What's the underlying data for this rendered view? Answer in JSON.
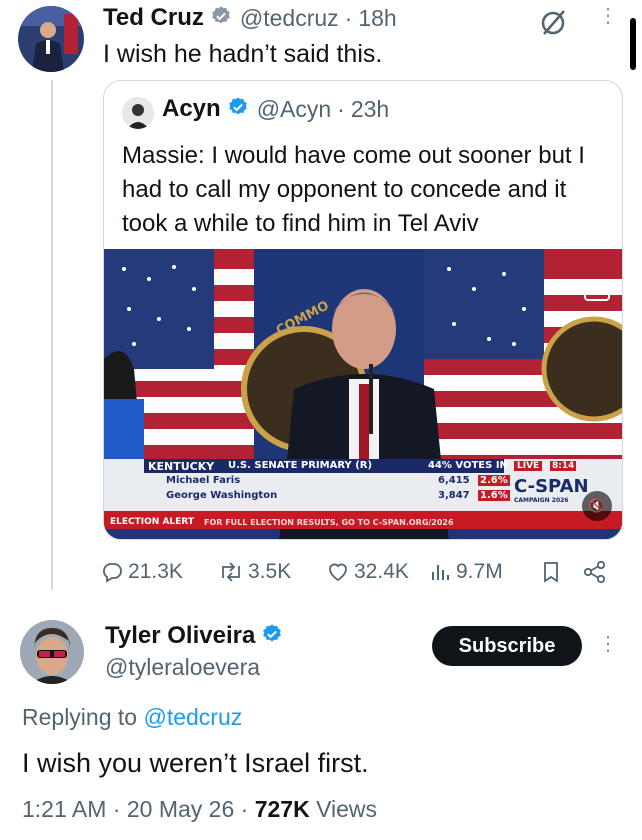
{
  "main_tweet": {
    "author": "Ted Cruz",
    "handle": "@tedcruz",
    "time": "18h",
    "text": "I wish he hadn’t said this."
  },
  "quote_tweet": {
    "author": "Acyn",
    "handle": "@Acyn",
    "time": "23h",
    "text": "Massie: I would have come out sooner but I had to call my opponent to concede and it took a while to find him in Tel Aviv",
    "video": {
      "lower_third": {
        "state": "KENTUCKY",
        "race": "U.S. SENATE PRIMARY (R)",
        "votes_in": "44% VOTES IN",
        "live": "LIVE",
        "time": "8:14",
        "candidates": [
          {
            "name": "Michael Faris",
            "votes": "6,415",
            "pct": "2.6%"
          },
          {
            "name": "George Washington",
            "votes": "3,847",
            "pct": "1.6%"
          }
        ],
        "alert_label": "ELECTION ALERT",
        "alert_text": "FOR FULL ELECTION RESULTS, GO TO C-SPAN.ORG/2026",
        "network": "C-SPAN",
        "network_sub": "CAMPAIGN 2026",
        "banner_word": "COMMO"
      },
      "cc_label": "CC"
    }
  },
  "stats": {
    "replies": "21.3K",
    "reposts": "3.5K",
    "likes": "32.4K",
    "views": "9.7M"
  },
  "reply": {
    "author": "Tyler Oliveira",
    "handle": "@tyleraloevera",
    "subscribe_label": "Subscribe",
    "replying_prefix": "Replying to",
    "replying_to": "@tedcruz",
    "text": "I wish you weren’t Israel first.",
    "time": "1:21 AM",
    "date": "20 May 26",
    "views": "727K",
    "views_label": "Views"
  },
  "separator": "·",
  "colors": {
    "verified_blue": "#1d9bf0",
    "secondary_text": "#536471",
    "link": "#1d9bf0"
  },
  "icons": [
    "grok-icon",
    "more-icon",
    "verified-icon",
    "reply-icon",
    "repost-icon",
    "like-icon",
    "views-icon",
    "bookmark-icon",
    "share-icon",
    "cc-icon",
    "mute-icon"
  ]
}
